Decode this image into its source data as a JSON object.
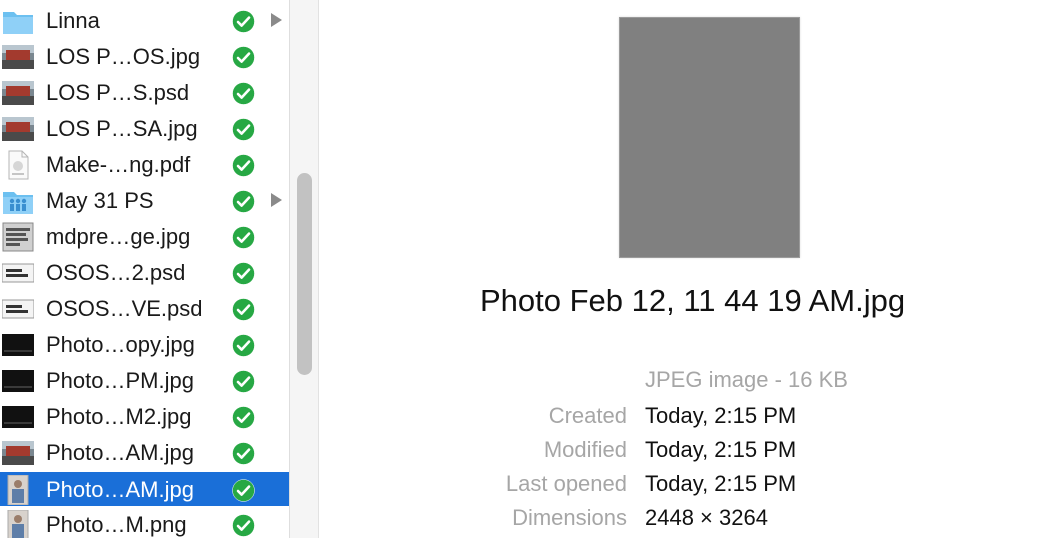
{
  "files": [
    {
      "name": "Linna",
      "icon": "folder-icon",
      "synced": true,
      "has_children": true
    },
    {
      "name": "LOS P…OS.jpg",
      "icon": "photo-thumbnail-icon",
      "synced": true
    },
    {
      "name": "LOS P…S.psd",
      "icon": "photo-thumbnail-icon",
      "synced": true
    },
    {
      "name": "LOS P…SA.jpg",
      "icon": "photo-thumbnail-icon",
      "synced": true
    },
    {
      "name": "Make-…ng.pdf",
      "icon": "pdf-document-icon",
      "synced": true
    },
    {
      "name": "May 31 PS",
      "icon": "shared-folder-icon",
      "synced": true,
      "has_children": true
    },
    {
      "name": "mdpre…ge.jpg",
      "icon": "text-image-thumbnail-icon",
      "synced": true
    },
    {
      "name": "OSOS…2.psd",
      "icon": "logo-thumbnail-icon",
      "synced": true
    },
    {
      "name": "OSOS…VE.psd",
      "icon": "logo-thumbnail-icon",
      "synced": true
    },
    {
      "name": "Photo…opy.jpg",
      "icon": "dark-photo-thumbnail-icon",
      "synced": true
    },
    {
      "name": "Photo…PM.jpg",
      "icon": "dark-photo-thumbnail-icon",
      "synced": true
    },
    {
      "name": "Photo…M2.jpg",
      "icon": "dark-photo-thumbnail-icon",
      "synced": true
    },
    {
      "name": "Photo…AM.jpg",
      "icon": "photo-thumbnail-icon",
      "synced": true
    },
    {
      "name": "Photo…AM.jpg",
      "icon": "portrait-thumbnail-icon",
      "synced": true,
      "selected": true
    },
    {
      "name": "Photo…M.png",
      "icon": "portrait-thumbnail-icon",
      "synced": true
    }
  ],
  "preview": {
    "title": "Photo Feb 12, 11 44 19 AM.jpg",
    "kind": "JPEG image - 16 KB",
    "details": [
      {
        "label": "Created",
        "value": "Today, 2:15 PM"
      },
      {
        "label": "Modified",
        "value": "Today, 2:15 PM"
      },
      {
        "label": "Last opened",
        "value": "Today, 2:15 PM"
      },
      {
        "label": "Dimensions",
        "value": "2448 × 3264"
      }
    ]
  },
  "colors": {
    "selection": "#1a6fd8",
    "sync_check": "#27a844",
    "folder": "#6cc0f0",
    "preview_placeholder": "#808080"
  }
}
